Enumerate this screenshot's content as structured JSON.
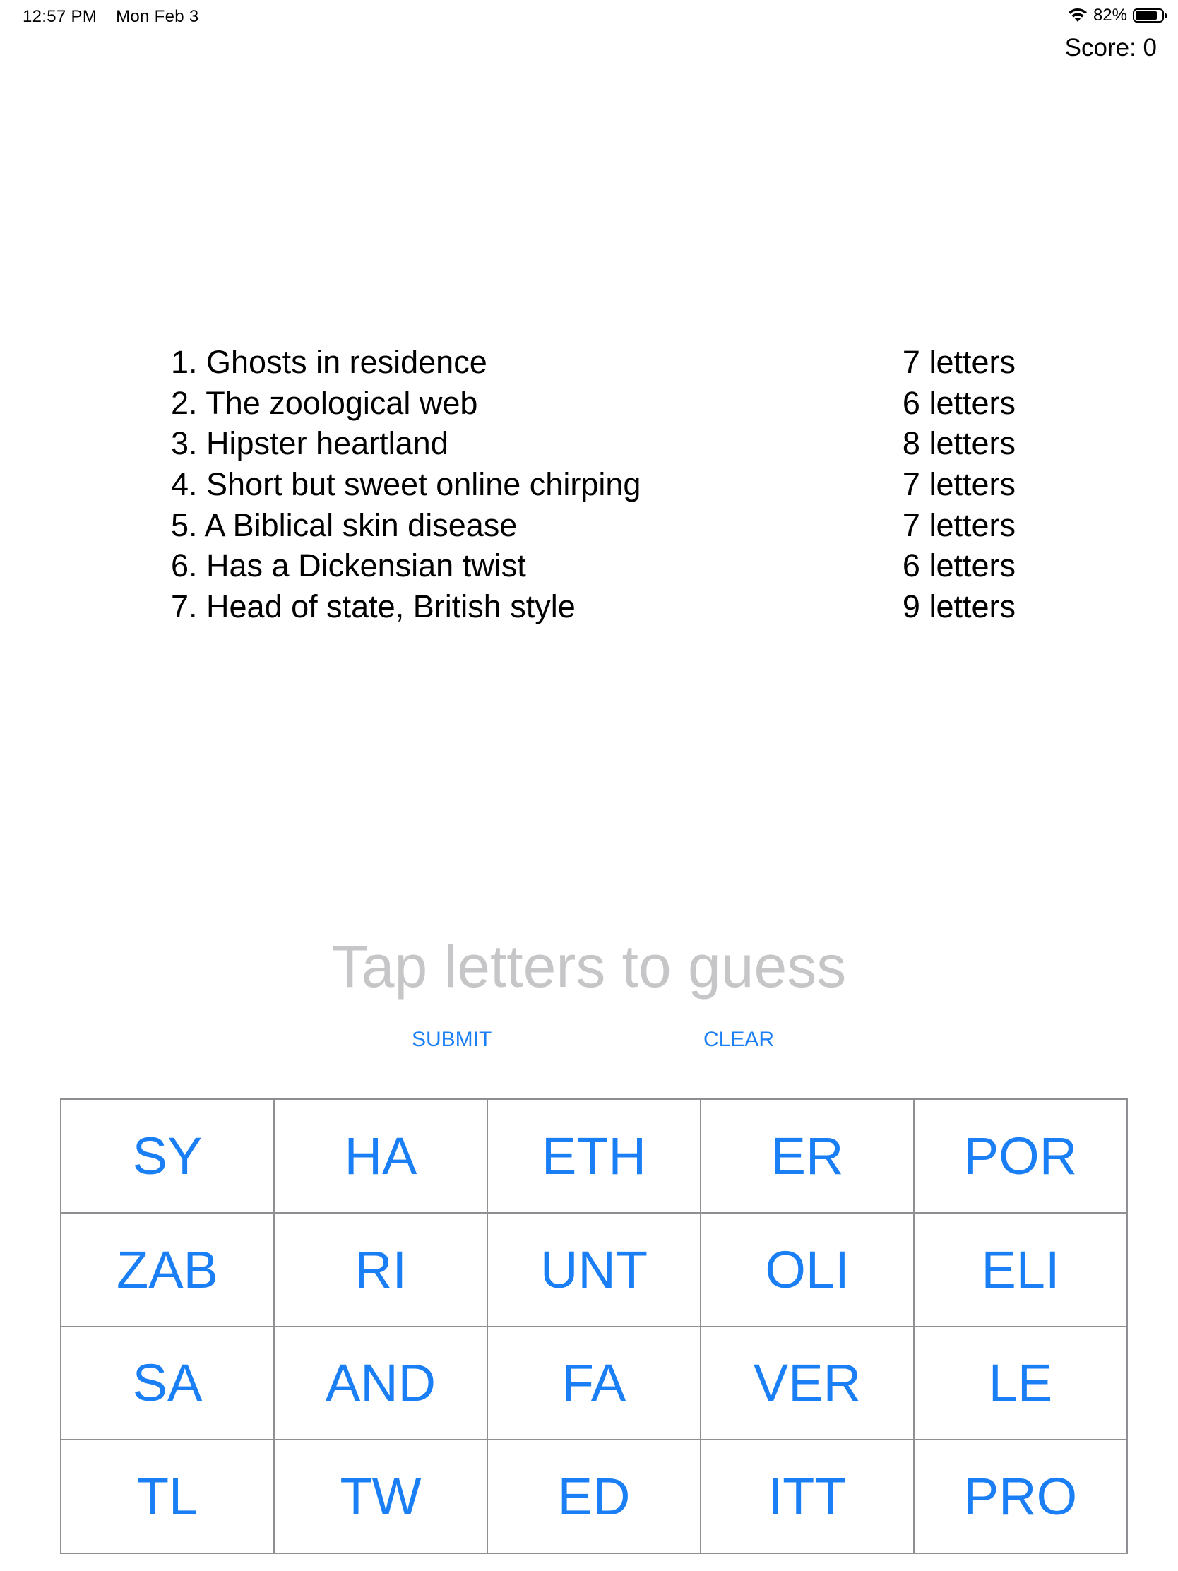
{
  "status_bar": {
    "time": "12:57 PM",
    "date": "Mon Feb 3",
    "battery_percent": "82%",
    "battery_level": 0.82,
    "icons": [
      "wifi-icon",
      "battery-icon"
    ]
  },
  "score": {
    "label": "Score: 0"
  },
  "clues": [
    {
      "text": "1. Ghosts in residence",
      "length": "7 letters"
    },
    {
      "text": "2. The zoological web",
      "length": "6 letters"
    },
    {
      "text": "3. Hipster heartland",
      "length": "8 letters"
    },
    {
      "text": "4. Short but sweet online chirping",
      "length": "7 letters"
    },
    {
      "text": "5. A Biblical skin disease",
      "length": "7 letters"
    },
    {
      "text": "6. Has a Dickensian twist",
      "length": "6 letters"
    },
    {
      "text": "7. Head of state, British style",
      "length": "9 letters"
    }
  ],
  "guess": {
    "placeholder": "Tap letters to guess"
  },
  "actions": {
    "submit_label": "SUBMIT",
    "clear_label": "CLEAR"
  },
  "tiles": [
    [
      "SY",
      "HA",
      "ETH",
      "ER",
      "POR"
    ],
    [
      "ZAB",
      "RI",
      "UNT",
      "OLI",
      "ELI"
    ],
    [
      "SA",
      "AND",
      "FA",
      "VER",
      "LE"
    ],
    [
      "TL",
      "TW",
      "ED",
      "ITT",
      "PRO"
    ]
  ],
  "colors": {
    "accent": "#1a7ef5",
    "placeholder": "#c6c6c8",
    "grid_border": "#8e8e93"
  }
}
